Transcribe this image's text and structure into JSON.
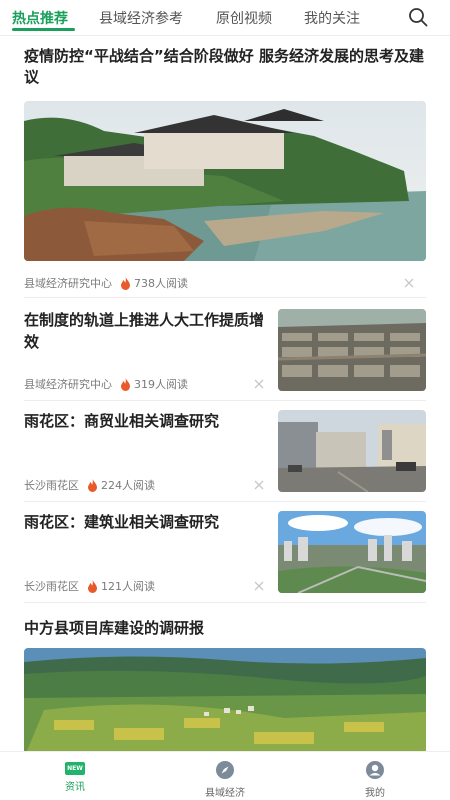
{
  "tabs": [
    {
      "label": "热点推荐"
    },
    {
      "label": "县域经济参考"
    },
    {
      "label": "原创视频"
    },
    {
      "label": "我的关注"
    }
  ],
  "colors": {
    "accent": "#1aa05c",
    "fire": "#e85a2a"
  },
  "articles": [
    {
      "title": "疫情防控“平战结合”结合阶段做好 服务经济发展的思考及建议",
      "source": "县域经济研究中心",
      "reads": "738人阅读"
    },
    {
      "title": "在制度的轨道上推进人大工作提质增效",
      "source": "县域经济研究中心",
      "reads": "319人阅读"
    },
    {
      "title": "雨花区：商贸业相关调查研究",
      "source": "长沙雨花区",
      "reads": "224人阅读"
    },
    {
      "title": "雨花区：建筑业相关调查研究",
      "source": "长沙雨花区",
      "reads": "121人阅读"
    },
    {
      "title": "中方县项目库建设的调研报",
      "source": "",
      "reads": ""
    }
  ],
  "nav": [
    {
      "label": "资讯",
      "icon": "new-badge-icon"
    },
    {
      "label": "县域经济",
      "icon": "compass-icon"
    },
    {
      "label": "我的",
      "icon": "user-icon"
    }
  ]
}
